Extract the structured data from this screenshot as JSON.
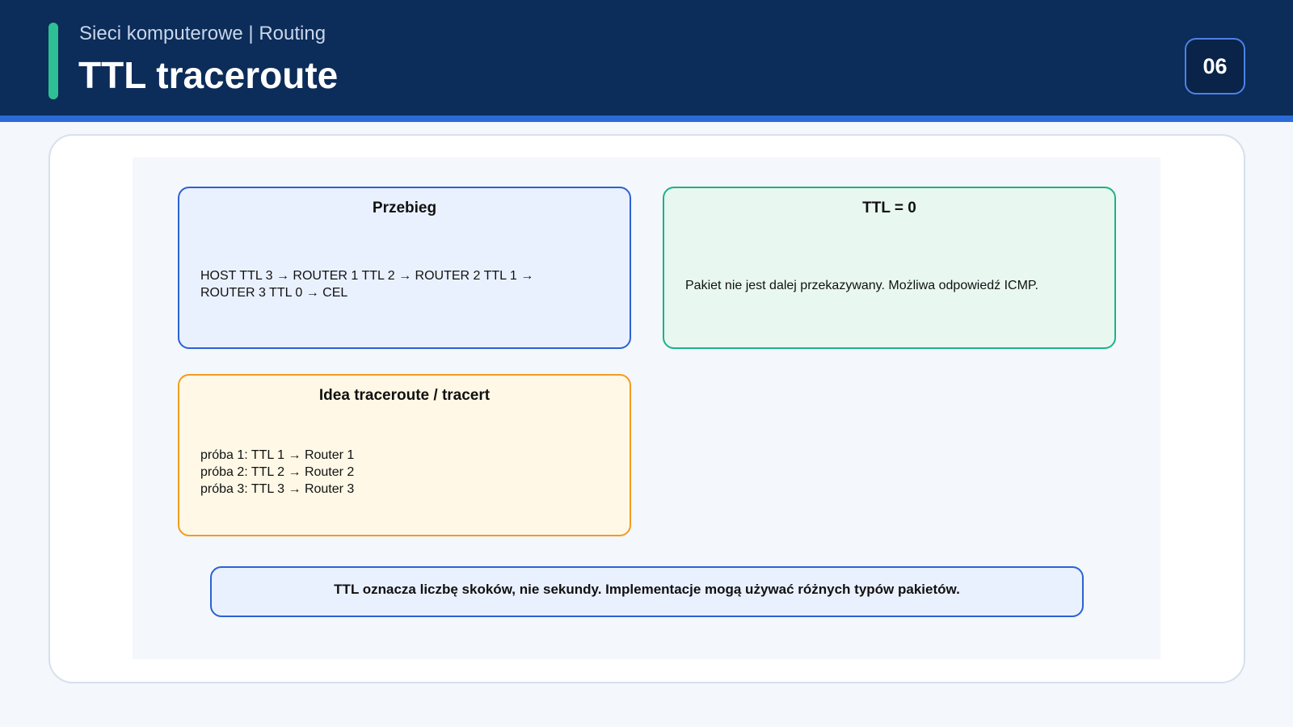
{
  "header": {
    "subtitle": "Sieci komputerowe | Routing",
    "title": "TTL traceroute",
    "page_number": "06"
  },
  "boxes": {
    "przebieg": {
      "title": "Przebieg",
      "lines": [
        "HOST TTL 3 → ROUTER 1 TTL 2 → ROUTER 2 TTL 1 →",
        "ROUTER 3 TTL 0 → CEL"
      ]
    },
    "ttl_zero": {
      "title": "TTL = 0",
      "lines": [
        "Pakiet nie jest dalej przekazywany. Możliwa odpowiedź ICMP."
      ]
    },
    "idea": {
      "title": "Idea traceroute / tracert",
      "lines": [
        "próba 1: TTL 1 → Router 1",
        "próba 2: TTL 2 → Router 2",
        "próba 3: TTL 3 → Router 3"
      ]
    }
  },
  "note": "TTL oznacza liczbę skoków, nie sekundy. Implementacje mogą używać różnych typów pakietów.",
  "colors": {
    "header_bg": "#0c2c59",
    "accent": "#2fbf95",
    "blue": "#2a62d4",
    "green": "#1cb384",
    "orange": "#f29c1f"
  }
}
